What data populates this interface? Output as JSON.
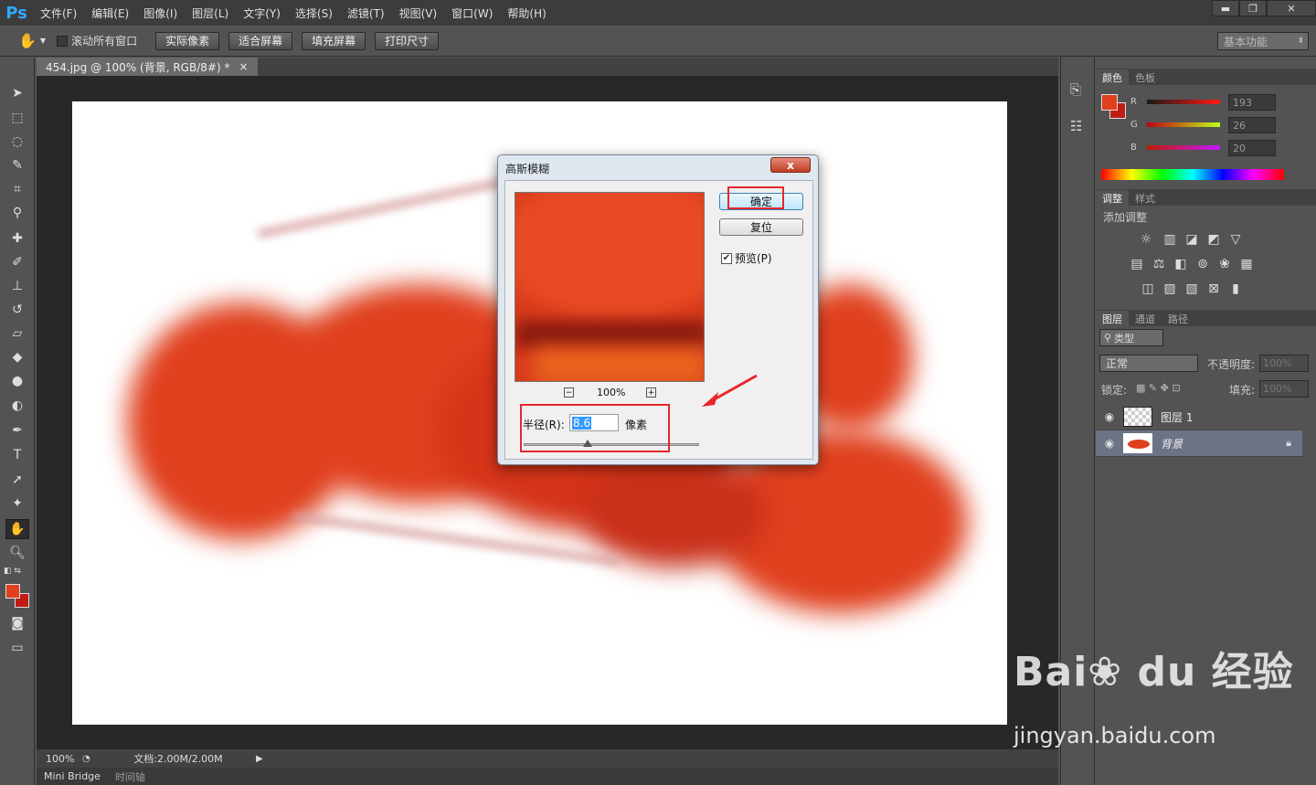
{
  "app": {
    "logo": "Ps"
  },
  "menu": [
    "文件(F)",
    "编辑(E)",
    "图像(I)",
    "图层(L)",
    "文字(Y)",
    "选择(S)",
    "滤镜(T)",
    "视图(V)",
    "窗口(W)",
    "帮助(H)"
  ],
  "window_controls": {
    "minimize": "▬",
    "restore": "❐",
    "close": "✕"
  },
  "options": {
    "scroll_all": "滚动所有窗口",
    "actual_pixels": "实际像素",
    "fit_screen": "适合屏幕",
    "fill_screen": "填充屏幕",
    "print_size": "打印尺寸",
    "workspace": "基本功能"
  },
  "document": {
    "tab_title": "454.jpg @ 100% (背景, RGB/8#) *",
    "tab_close": "×"
  },
  "status": {
    "zoom": "100%",
    "doc_info": "文档:2.00M/2.00M"
  },
  "bottom_tabs": [
    "Mini Bridge",
    "时间轴"
  ],
  "colors": {
    "foreground": "#e0401e",
    "background": "#c01c14"
  },
  "color_panel": {
    "tabs": [
      "颜色",
      "色板"
    ],
    "r_label": "R",
    "g_label": "G",
    "b_label": "B",
    "r_value": "193",
    "g_value": "26",
    "b_value": "20"
  },
  "adjustments_panel": {
    "tabs": [
      "调整",
      "样式"
    ],
    "heading": "添加调整"
  },
  "layers_panel": {
    "tabs": [
      "图层",
      "通道",
      "路径"
    ],
    "filter_kind": "类型",
    "blend_mode": "正常",
    "opacity_label": "不透明度:",
    "opacity_value": "100%",
    "lock_label": "锁定:",
    "fill_label": "填充:",
    "fill_value": "100%",
    "layers": [
      {
        "name": "图层 1"
      },
      {
        "name": "背景"
      }
    ]
  },
  "dialog": {
    "title": "高斯模糊",
    "close": "x",
    "ok": "确定",
    "reset": "复位",
    "preview_label": "预览(P)",
    "preview_checked": true,
    "zoom_out": "−",
    "zoom_in": "+",
    "zoom_value": "100%",
    "radius_label": "半径(R):",
    "radius_value": "8.6",
    "radius_unit": "像素",
    "radius_slider_fraction": 0.36
  },
  "watermark": {
    "url": "jingyan.baidu.com"
  }
}
